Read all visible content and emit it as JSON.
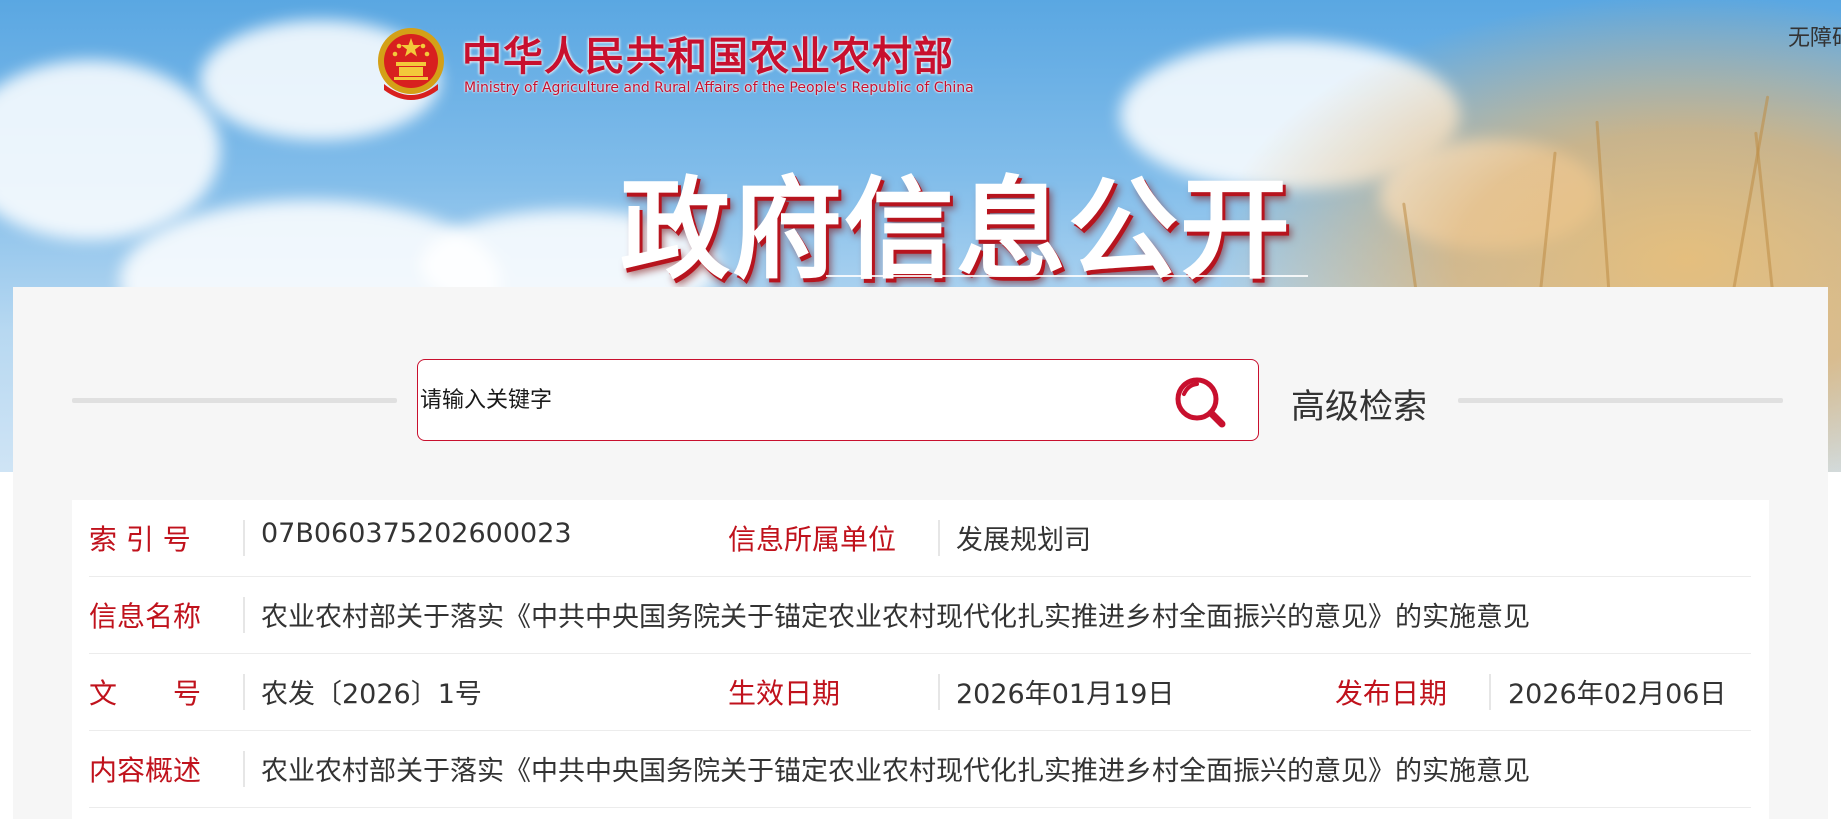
{
  "header": {
    "accessibility_label": "无障碍",
    "site_name_cn": "中华人民共和国农业农村部",
    "site_name_en": "Ministry of Agriculture and Rural Affairs of the People's Republic of China",
    "hero_title": "政府信息公开",
    "emblem_icon": "national-emblem-icon"
  },
  "search": {
    "placeholder": "请输入关键字",
    "search_icon": "search-icon",
    "advanced_label": "高级检索"
  },
  "info": {
    "index_label": "索 引 号",
    "index_value": "07B060375202600023",
    "unit_label": "信息所属单位",
    "unit_value": "发展规划司",
    "name_label": "信息名称",
    "name_value": "农业农村部关于落实《中共中央国务院关于锚定农业农村现代化扎实推进乡村全面振兴的意见》的实施意见",
    "doc_label": "文　　号",
    "doc_value": "农发〔2026〕1号",
    "effective_label": "生效日期",
    "effective_value": "2026年01月19日",
    "publish_label": "发布日期",
    "publish_value": "2026年02月06日",
    "summary_label": "内容概述",
    "summary_value": "农业农村部关于落实《中共中央国务院关于锚定农业农村现代化扎实推进乡村全面振兴的意见》的实施意见"
  },
  "colors": {
    "accent_red": "#c8102e",
    "label_red": "#c0121c",
    "sky_blue": "#5aa7e2"
  }
}
